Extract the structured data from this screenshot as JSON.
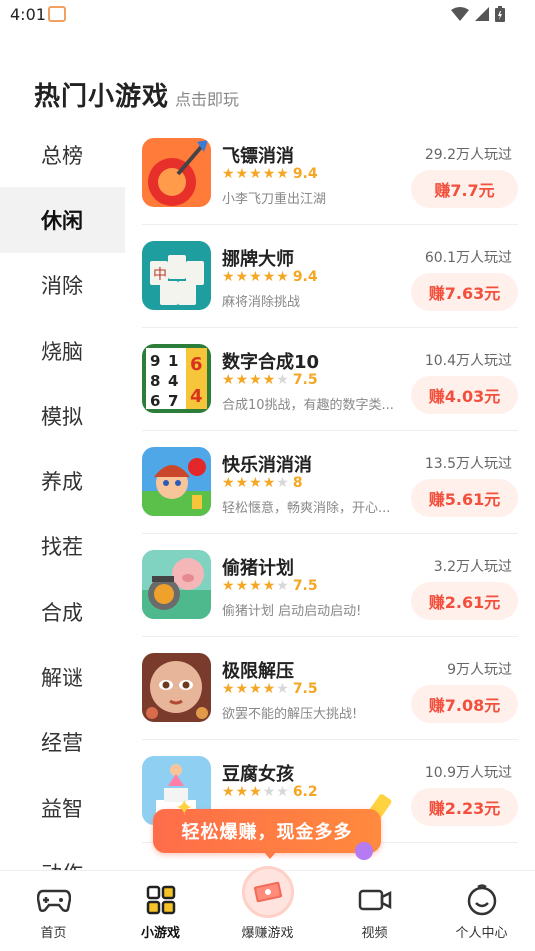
{
  "status_bar": {
    "time": "4:01"
  },
  "header": {
    "title": "热门小游戏",
    "subtitle": "点击即玩"
  },
  "categories": [
    {
      "label": "总榜",
      "active": false
    },
    {
      "label": "休闲",
      "active": true
    },
    {
      "label": "消除",
      "active": false
    },
    {
      "label": "烧脑",
      "active": false
    },
    {
      "label": "模拟",
      "active": false
    },
    {
      "label": "养成",
      "active": false
    },
    {
      "label": "找茬",
      "active": false
    },
    {
      "label": "合成",
      "active": false
    },
    {
      "label": "解谜",
      "active": false
    },
    {
      "label": "经营",
      "active": false
    },
    {
      "label": "益智",
      "active": false
    },
    {
      "label": "动作",
      "active": false
    }
  ],
  "games": [
    {
      "name": "飞镖消消",
      "rating": "9.4",
      "stars": 4.5,
      "desc": "小李飞刀重出江湖",
      "plays": "29.2万人玩过",
      "earn": "赚7.7元"
    },
    {
      "name": "挪牌大师",
      "rating": "9.4",
      "stars": 4.5,
      "desc": "麻将消除挑战",
      "plays": "60.1万人玩过",
      "earn": "赚7.63元"
    },
    {
      "name": "数字合成10",
      "rating": "7.5",
      "stars": 3.5,
      "desc": "合成10挑战，有趣的数字类...",
      "plays": "10.4万人玩过",
      "earn": "赚4.03元"
    },
    {
      "name": "快乐消消消",
      "rating": "8",
      "stars": 4,
      "desc": "轻松惬意，畅爽消除，开心...",
      "plays": "13.5万人玩过",
      "earn": "赚5.61元"
    },
    {
      "name": "偷猪计划",
      "rating": "7.5",
      "stars": 3.5,
      "desc": "偷猪计划 启动启动启动!",
      "plays": "3.2万人玩过",
      "earn": "赚2.61元"
    },
    {
      "name": "极限解压",
      "rating": "7.5",
      "stars": 3.5,
      "desc": "欲罢不能的解压大挑战!",
      "plays": "9万人玩过",
      "earn": "赚7.08元"
    },
    {
      "name": "豆腐女孩",
      "rating": "6.2",
      "stars": 3,
      "desc": "",
      "plays": "10.9万人玩过",
      "earn": "赚2.23元"
    }
  ],
  "promo": {
    "text": "轻松爆赚，现金多多"
  },
  "bottom_nav": [
    {
      "label": "首页",
      "icon": "gamepad-icon",
      "active": false
    },
    {
      "label": "小游戏",
      "icon": "grid-icon",
      "active": true
    },
    {
      "label": "爆赚游戏",
      "icon": "cash-icon",
      "active": false
    },
    {
      "label": "视频",
      "icon": "video-icon",
      "active": false
    },
    {
      "label": "个人中心",
      "icon": "smile-icon",
      "active": false
    }
  ],
  "colors": {
    "accent": "#f2503c",
    "star": "#f5a623",
    "earn_bg": "#fff0ec"
  }
}
